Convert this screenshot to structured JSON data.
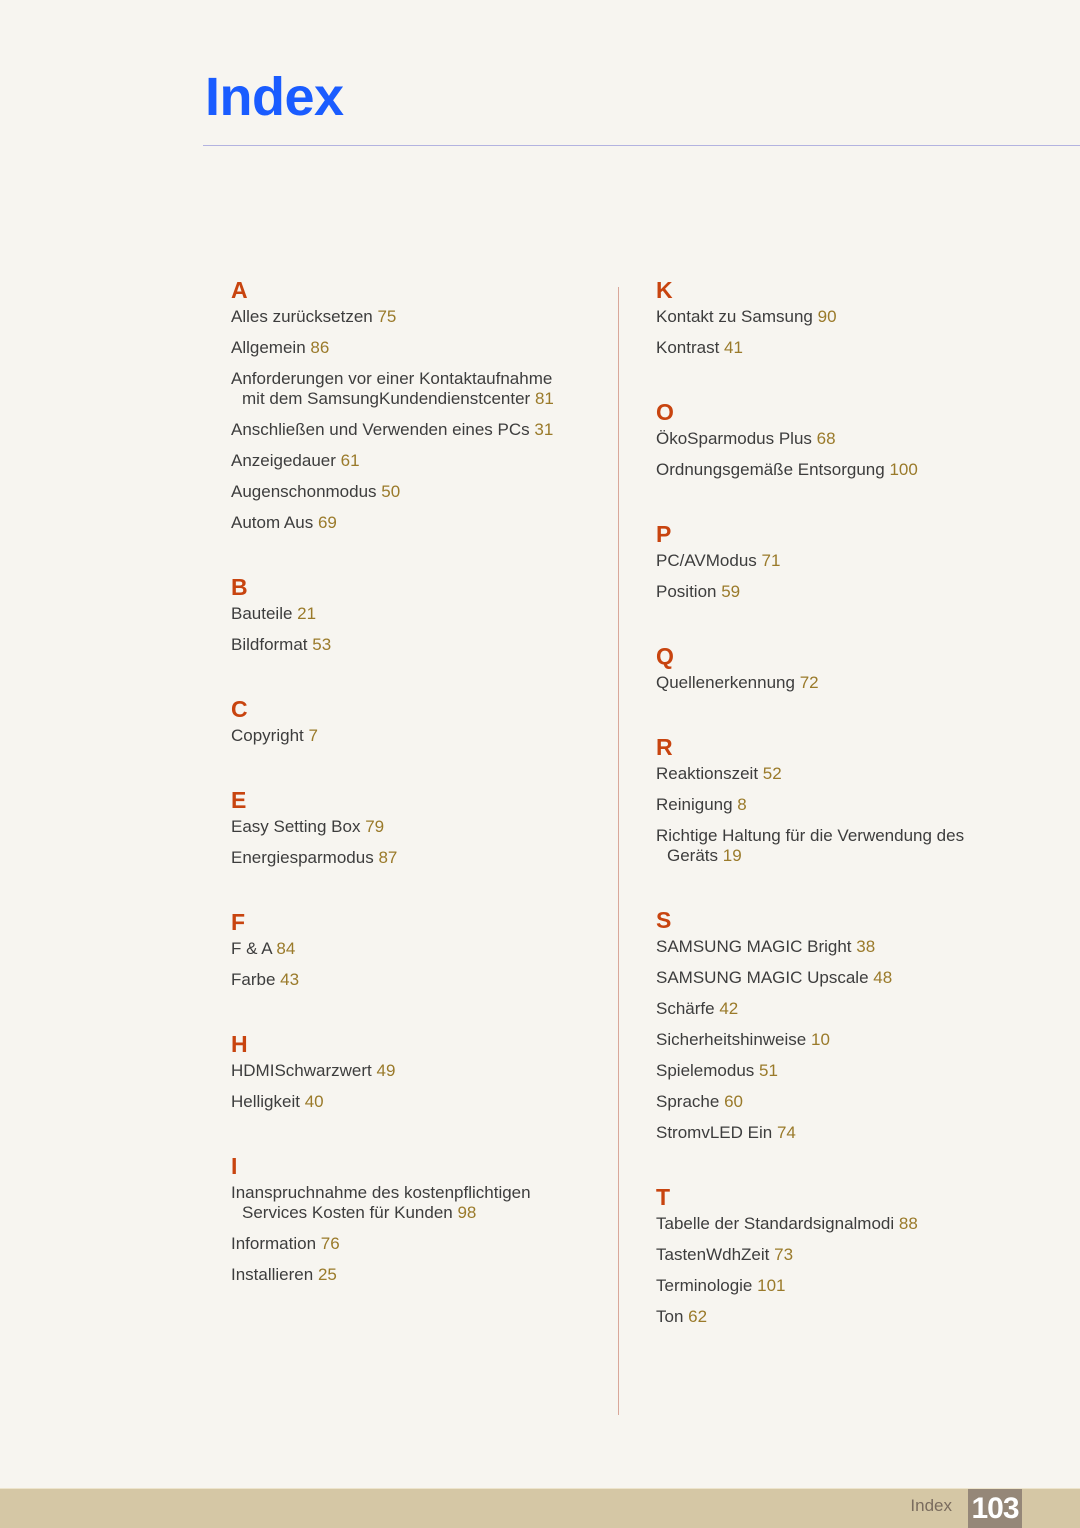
{
  "header": {
    "title": "Index"
  },
  "colors": {
    "title": "#1a5cff",
    "letter": "#c8440f",
    "page_number": "#9a7a2a",
    "footer_bg": "#d5c7a5"
  },
  "left_column": [
    {
      "letter": "A",
      "entries": [
        {
          "text": "Alles zurücksetzen",
          "page": "75"
        },
        {
          "text": "Allgemein",
          "page": "86"
        },
        {
          "text": "Anforderungen vor einer Kontaktaufnahme",
          "cont": "mit dem SamsungKundendienstcenter",
          "page": "81"
        },
        {
          "text": "Anschließen und Verwenden eines PCs",
          "page": "31"
        },
        {
          "text": "Anzeigedauer",
          "page": "61"
        },
        {
          "text": "Augenschonmodus",
          "page": "50"
        },
        {
          "text": "Autom Aus",
          "page": "69"
        }
      ]
    },
    {
      "letter": "B",
      "entries": [
        {
          "text": "Bauteile",
          "page": "21"
        },
        {
          "text": "Bildformat",
          "page": "53"
        }
      ]
    },
    {
      "letter": "C",
      "entries": [
        {
          "text": "Copyright",
          "page": "7"
        }
      ]
    },
    {
      "letter": "E",
      "entries": [
        {
          "text": "Easy Setting Box",
          "page": "79"
        },
        {
          "text": "Energiesparmodus",
          "page": "87"
        }
      ]
    },
    {
      "letter": "F",
      "entries": [
        {
          "text": "F & A",
          "page": "84"
        },
        {
          "text": "Farbe",
          "page": "43"
        }
      ]
    },
    {
      "letter": "H",
      "entries": [
        {
          "text": "HDMISchwarzwert",
          "page": "49"
        },
        {
          "text": "Helligkeit",
          "page": "40"
        }
      ]
    },
    {
      "letter": "I",
      "entries": [
        {
          "text": "Inanspruchnahme des kostenpflichtigen",
          "cont": "Services Kosten für Kunden",
          "page": "98"
        },
        {
          "text": "Information",
          "page": "76"
        },
        {
          "text": "Installieren",
          "page": "25"
        }
      ]
    }
  ],
  "right_column": [
    {
      "letter": "K",
      "entries": [
        {
          "text": "Kontakt zu Samsung",
          "page": "90"
        },
        {
          "text": "Kontrast",
          "page": "41"
        }
      ]
    },
    {
      "letter": "O",
      "entries": [
        {
          "text": "ÖkoSparmodus Plus",
          "page": "68"
        },
        {
          "text": "Ordnungsgemäße Entsorgung",
          "page": "100"
        }
      ]
    },
    {
      "letter": "P",
      "entries": [
        {
          "text": "PC/AVModus",
          "page": "71"
        },
        {
          "text": "Position",
          "page": "59"
        }
      ]
    },
    {
      "letter": "Q",
      "entries": [
        {
          "text": "Quellenerkennung",
          "page": "72"
        }
      ]
    },
    {
      "letter": "R",
      "entries": [
        {
          "text": "Reaktionszeit",
          "page": "52"
        },
        {
          "text": "Reinigung",
          "page": "8"
        },
        {
          "text": "Richtige Haltung für die Verwendung des",
          "cont": "Geräts",
          "page": "19"
        }
      ]
    },
    {
      "letter": "S",
      "entries": [
        {
          "text": "SAMSUNG MAGIC Bright",
          "page": "38"
        },
        {
          "text": "SAMSUNG MAGIC Upscale",
          "page": "48"
        },
        {
          "text": "Schärfe",
          "page": "42"
        },
        {
          "text": "Sicherheitshinweise",
          "page": "10"
        },
        {
          "text": "Spielemodus",
          "page": "51"
        },
        {
          "text": "Sprache",
          "page": "60"
        },
        {
          "text": "StromvLED Ein",
          "page": "74"
        }
      ]
    },
    {
      "letter": "T",
      "entries": [
        {
          "text": "Tabelle der Standardsignalmodi",
          "page": "88"
        },
        {
          "text": "TastenWdhZeit",
          "page": "73"
        },
        {
          "text": "Terminologie",
          "page": "101"
        },
        {
          "text": "Ton",
          "page": "62"
        }
      ]
    }
  ],
  "footer": {
    "label": "Index",
    "page_number": "103"
  }
}
